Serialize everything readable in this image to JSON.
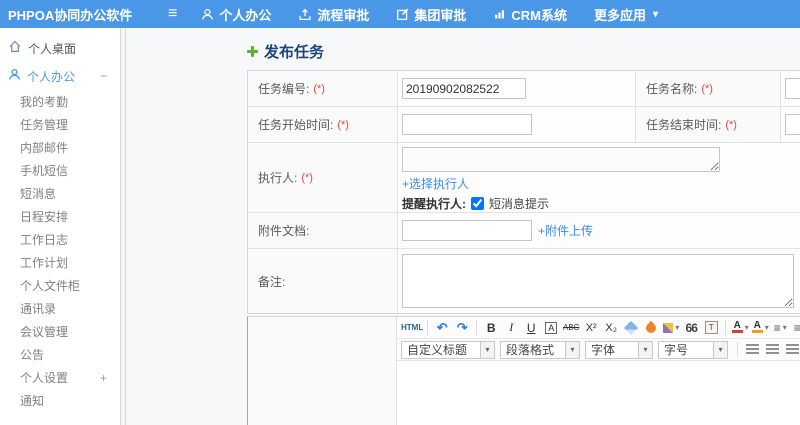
{
  "topbar": {
    "brand": "PHPOA协同办公软件",
    "menu_icon": "≡",
    "caret": "▾",
    "nav": [
      {
        "label": "个人办公"
      },
      {
        "label": "流程审批"
      },
      {
        "label": "集团审批"
      },
      {
        "label": "CRM系统"
      },
      {
        "label": "更多应用"
      }
    ]
  },
  "sidebar": {
    "desktop": "个人桌面",
    "office": "个人办公",
    "office_toggle": "−",
    "items": [
      "我的考勤",
      "任务管理",
      "内部邮件",
      "手机短信",
      "短消息",
      "日程安排",
      "工作日志",
      "工作计划",
      "个人文件柜",
      "通讯录",
      "会议管理",
      "公告"
    ],
    "settings": "个人设置",
    "settings_toggle": "+",
    "notice": "通知"
  },
  "form": {
    "title": "发布任务",
    "required_mark": "(*)",
    "task_no": {
      "label": "任务编号:",
      "value": "20190902082522"
    },
    "task_name": {
      "label": "任务名称:"
    },
    "start_time": {
      "label": "任务开始时间:"
    },
    "end_time": {
      "label": "任务结束时间:"
    },
    "executor": {
      "label": "执行人:",
      "select_link": "+选择执行人",
      "remind_label": "提醒执行人:",
      "sms_option": "短消息提示",
      "sms_checked": true
    },
    "attachment": {
      "label": "附件文档:",
      "upload_link": "+附件上传"
    },
    "note": {
      "label": "备注:"
    }
  },
  "editor": {
    "source_label": "HTML",
    "caret": "▾",
    "icons": {
      "undo": "↶",
      "redo": "↷",
      "bold": "B",
      "italic": "I",
      "underline": "U",
      "font_box": "A",
      "strike": "ABC",
      "sup": "X²",
      "sub": "X₂",
      "quote": "66",
      "paste": "T",
      "font_color": "A",
      "ordered_list": "≡",
      "unordered_list": "≡",
      "link": "∞",
      "unlink": "∞"
    },
    "selects": [
      {
        "label": "自定义标题"
      },
      {
        "label": "段落格式"
      },
      {
        "label": "字体"
      },
      {
        "label": "字号"
      }
    ]
  },
  "colors": {
    "topbar_blue": "#4a97e8",
    "title_navy": "#17477e",
    "link_blue": "#3a8ce8",
    "required_red": "#e64444",
    "add_green": "#5db428"
  }
}
